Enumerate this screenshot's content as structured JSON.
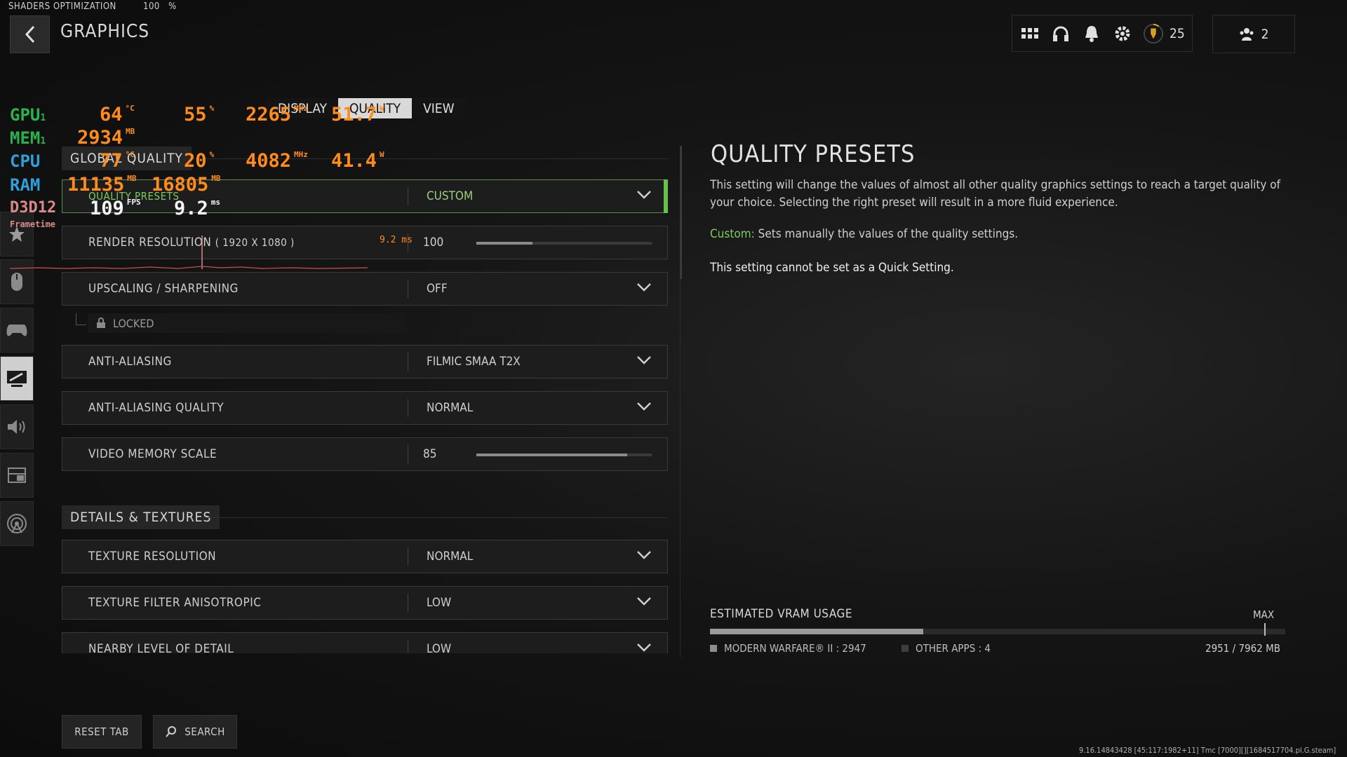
{
  "header": {
    "shader_label": "SHADERS OPTIMIZATION",
    "shader_value": "100",
    "shader_unit": "%",
    "title": "GRAPHICS",
    "level": "25",
    "party_count": "2"
  },
  "tabs": [
    {
      "label": "DISPLAY"
    },
    {
      "label": "QUALITY"
    },
    {
      "label": "VIEW"
    }
  ],
  "sidebar_icons": [
    "star-icon",
    "mouse-icon",
    "controller-icon",
    "display-icon",
    "speaker-icon",
    "interface-icon",
    "network-icon"
  ],
  "section_global": "GLOBAL QUALITY",
  "section_details": "DETAILS & TEXTURES",
  "rows": {
    "presets": {
      "label": "QUALITY PRESETS",
      "value": "CUSTOM"
    },
    "render": {
      "label": "RENDER RESOLUTION",
      "sub": "( 1920 X 1080 )",
      "value": "100",
      "level": 0.32
    },
    "upscale": {
      "label": "UPSCALING / SHARPENING",
      "value": "OFF"
    },
    "locked": "LOCKED",
    "aa": {
      "label": "ANTI-ALIASING",
      "value": "FILMIC SMAA T2X"
    },
    "aaq": {
      "label": "ANTI-ALIASING QUALITY",
      "value": "NORMAL"
    },
    "vms": {
      "label": "VIDEO MEMORY SCALE",
      "value": "85",
      "level": 0.86
    },
    "texres": {
      "label": "TEXTURE RESOLUTION",
      "value": "NORMAL"
    },
    "texfilt": {
      "label": "TEXTURE FILTER ANISOTROPIC",
      "value": "LOW"
    },
    "nlod": {
      "label": "NEARBY LEVEL OF DETAIL",
      "value": "LOW"
    }
  },
  "panel": {
    "heading": "QUALITY PRESETS",
    "description": "This setting will change the values of almost all other quality graphics settings to reach a target quality of your choice. Selecting the right preset will result in a more fluid experience.",
    "custom_label": "Custom:",
    "custom_text": "Sets manually the values of the quality settings.",
    "note": "This setting cannot be set as a Quick Setting."
  },
  "vram": {
    "title": "ESTIMATED VRAM USAGE",
    "max_label": "MAX",
    "game_legend": "MODERN WARFARE® II : 2947",
    "other_legend": "OTHER APPS : 4",
    "total": "2951 / 7962 MB",
    "game_mb": 2947,
    "other_mb": 4,
    "capacity_mb": 7962
  },
  "buttons": {
    "reset": "RESET TAB",
    "search": "SEARCH"
  },
  "build": "9.16.14843428 [45:117:1982+11] Tmc [7000][][1684517704.pl.G.steam]",
  "overlay": {
    "gpu_label": "GPU",
    "gpu_idx": "1",
    "gpu_temp": "64",
    "gpu_temp_unit": "°C",
    "gpu_load": "55",
    "gpu_load_unit": "%",
    "gpu_clock": "2265",
    "gpu_clock_unit": "MHz",
    "gpu_power": "51.7",
    "gpu_power_unit": "W",
    "mem_label": "MEM",
    "mem_idx": "1",
    "mem_val": "2934",
    "mem_unit": "MB",
    "cpu_label": "CPU",
    "cpu_temp": "77",
    "cpu_temp_unit": "°C",
    "cpu_load": "20",
    "cpu_load_unit": "%",
    "cpu_clock": "4082",
    "cpu_clock_unit": "MHz",
    "cpu_power": "41.4",
    "cpu_power_unit": "W",
    "ram_label": "RAM",
    "ram_used": "11135",
    "ram_used_unit": "MB",
    "ram_total": "16805",
    "ram_total_unit": "MB",
    "api_label": "D3D12",
    "fps": "109",
    "fps_unit": "FPS",
    "frametime": "9.2",
    "frametime_unit": "ms",
    "frametime_label": "Frametime",
    "frametime_graph_value": "9.2 ms"
  }
}
